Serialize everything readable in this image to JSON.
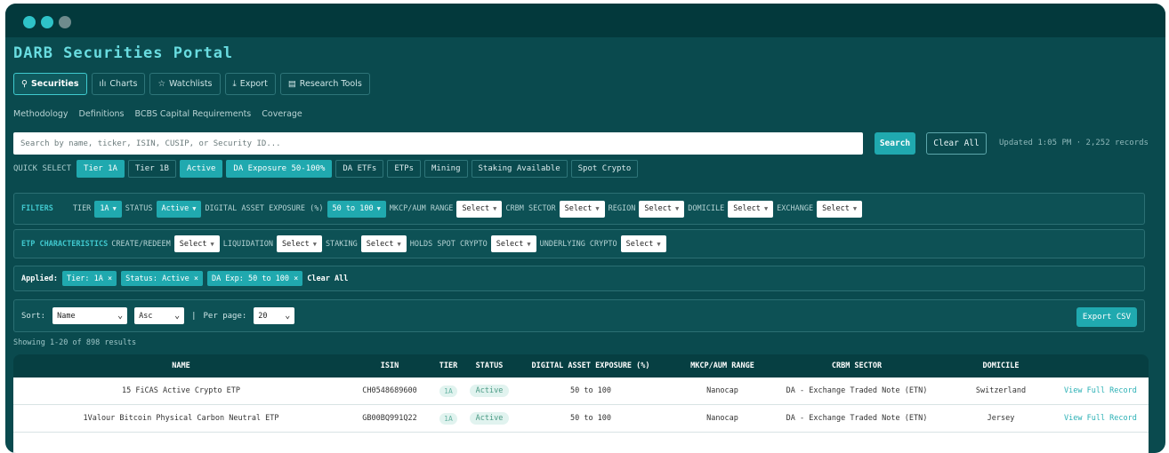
{
  "app": {
    "title": "DARB Securities Portal"
  },
  "tabs": [
    {
      "icon": "search-icon",
      "glyph": "⚲",
      "label": "Securities"
    },
    {
      "icon": "chart-icon",
      "glyph": "ılı",
      "label": "Charts"
    },
    {
      "icon": "star-icon",
      "glyph": "☆",
      "label": "Watchlists"
    },
    {
      "icon": "download-icon",
      "glyph": "⤓",
      "label": "Export"
    },
    {
      "icon": "clipboard-icon",
      "glyph": "▤",
      "label": "Research Tools"
    }
  ],
  "subnav": [
    "Methodology",
    "Definitions",
    "BCBS Capital Requirements",
    "Coverage"
  ],
  "search": {
    "placeholder": "Search by name, ticker, ISIN, CUSIP, or Security ID...",
    "search_label": "Search",
    "clear_label": "Clear All",
    "updated": "Updated 1:05 PM · 2,252 records"
  },
  "quick_select": {
    "label": "QUICK SELECT",
    "chips": [
      "Tier 1A",
      "Tier 1B",
      "Active",
      "DA Exposure 50-100%",
      "DA ETFs",
      "ETPs",
      "Mining",
      "Staking Available",
      "Spot Crypto"
    ]
  },
  "filters": {
    "title": "FILTERS",
    "tier_label": "TIER",
    "tier_value": "1A",
    "status_label": "STATUS",
    "status_value": "Active",
    "exposure_label": "DIGITAL ASSET EXPOSURE (%)",
    "exposure_value": "50 to 100",
    "mkcp_label": "MKCP/AUM RANGE",
    "mkcp_value": "Select",
    "sector_label": "CRBM SECTOR",
    "sector_value": "Select",
    "region_label": "REGION",
    "region_value": "Select",
    "domicile_label": "DOMICILE",
    "domicile_value": "Select",
    "exchange_label": "EXCHANGE",
    "exchange_value": "Select"
  },
  "etp": {
    "title": "ETP CHARACTERISTICS",
    "create_label": "CREATE/REDEEM",
    "create_value": "Select",
    "liquidation_label": "LIQUIDATION",
    "liquidation_value": "Select",
    "staking_label": "STAKING",
    "staking_value": "Select",
    "spot_label": "HOLDS SPOT CRYPTO",
    "spot_value": "Select",
    "underlying_label": "UNDERLYING CRYPTO",
    "underlying_value": "Select"
  },
  "applied": {
    "label": "Applied:",
    "pills": [
      "Tier: 1A ×",
      "Status: Active ×",
      "DA Exp: 50 to 100 ×"
    ],
    "clear": "Clear All"
  },
  "sort": {
    "label": "Sort:",
    "field": "Name",
    "order": "Asc",
    "separator": "|",
    "per_page_label": "Per page:",
    "per_page": "20",
    "export_label": "Export CSV"
  },
  "results": {
    "showing": "Showing 1-20 of 898 results"
  },
  "table": {
    "headers": [
      "NAME",
      "ISIN",
      "TIER",
      "STATUS",
      "DIGITAL ASSET EXPOSURE (%)",
      "MKCP/AUM RANGE",
      "CRBM SECTOR",
      "DOMICILE",
      ""
    ],
    "rows": [
      {
        "name": "15 FiCAS Active Crypto ETP",
        "isin": "CH0548689600",
        "tier": "1A",
        "status": "Active",
        "exposure": "50 to 100",
        "mkcp": "Nanocap",
        "sector": "DA - Exchange Traded Note (ETN)",
        "domicile": "Switzerland",
        "action": "View Full Record"
      },
      {
        "name": "1Valour Bitcoin Physical Carbon Neutral ETP",
        "isin": "GB00BQ991Q22",
        "tier": "1A",
        "status": "Active",
        "exposure": "50 to 100",
        "mkcp": "Nanocap",
        "sector": "DA - Exchange Traded Note (ETN)",
        "domicile": "Jersey",
        "action": "View Full Record"
      },
      {
        "name": "",
        "isin": "",
        "tier": "",
        "status": "",
        "exposure": "",
        "mkcp": "",
        "sector": "",
        "domicile": "",
        "action": ""
      }
    ]
  },
  "colors": {
    "background": "#0a4a4e",
    "accent": "#20a9af",
    "title": "#69dce0",
    "header": "#063f42"
  }
}
